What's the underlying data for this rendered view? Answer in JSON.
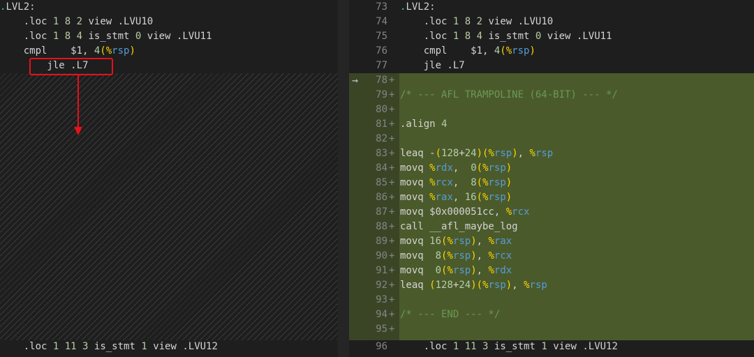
{
  "left": {
    "lines": [
      ".LVL2:",
      "    .loc 1 8 2 view .LVU10",
      "    .loc 1 8 4 is_stmt 0 view .LVU11",
      "    cmpl    $1, 4(%rsp)",
      "        jle .L7"
    ],
    "bottom_line": "    .loc 1 11 3 is_stmt 1 view .LVU12"
  },
  "right": {
    "context_lines": [
      {
        "num": "73",
        "text": ".LVL2:"
      },
      {
        "num": "74",
        "text": "    .loc 1 8 2 view .LVU10"
      },
      {
        "num": "75",
        "text": "    .loc 1 8 4 is_stmt 0 view .LVU11"
      },
      {
        "num": "76",
        "text": "    cmpl    $1, 4(%rsp)"
      },
      {
        "num": "77",
        "text": "    jle .L7"
      }
    ],
    "added_lines": [
      {
        "num": "78",
        "text": ""
      },
      {
        "num": "79",
        "text": "/* --- AFL TRAMPOLINE (64-BIT) --- */"
      },
      {
        "num": "80",
        "text": ""
      },
      {
        "num": "81",
        "text": ".align 4"
      },
      {
        "num": "82",
        "text": ""
      },
      {
        "num": "83",
        "text": "leaq -(128+24)(%rsp), %rsp"
      },
      {
        "num": "84",
        "text": "movq %rdx,  0(%rsp)"
      },
      {
        "num": "85",
        "text": "movq %rcx,  8(%rsp)"
      },
      {
        "num": "86",
        "text": "movq %rax, 16(%rsp)"
      },
      {
        "num": "87",
        "text": "movq $0x000051cc, %rcx"
      },
      {
        "num": "88",
        "text": "call __afl_maybe_log"
      },
      {
        "num": "89",
        "text": "movq 16(%rsp), %rax"
      },
      {
        "num": "90",
        "text": "movq  8(%rsp), %rcx"
      },
      {
        "num": "91",
        "text": "movq  0(%rsp), %rdx"
      },
      {
        "num": "92",
        "text": "leaq (128+24)(%rsp), %rsp"
      },
      {
        "num": "93",
        "text": ""
      },
      {
        "num": "94",
        "text": "/* --- END --- */"
      },
      {
        "num": "95",
        "text": ""
      }
    ],
    "bottom_line": {
      "num": "96",
      "text": "    .loc 1 11 3 is_stmt 1 view .LVU12"
    },
    "plus_marker": "+",
    "arrow_glyph": "→"
  },
  "colors": {
    "added_background": "#4b5a2b",
    "highlight_box": "#e8101a",
    "label": "#4ec9b0",
    "number": "#b5cea8",
    "register": "#569cd6",
    "paren": "#ffd700",
    "comment": "#6a9955"
  }
}
